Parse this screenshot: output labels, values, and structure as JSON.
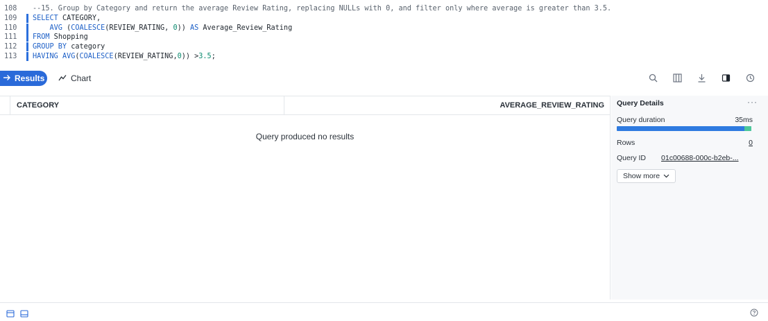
{
  "editor": {
    "lines": [
      {
        "num": "108",
        "segments": [
          {
            "t": "--15. Group by Category and return the average Review Rating, replacing NULLs with 0, and filter only where average is greater than 3.5.",
            "c": "cm"
          }
        ],
        "bar": false
      },
      {
        "num": "109",
        "segments": [
          {
            "t": "SELECT",
            "c": "kw"
          },
          {
            "t": " CATEGORY,",
            "c": "id"
          }
        ],
        "bar": true
      },
      {
        "num": "110",
        "segments": [
          {
            "t": "    AVG",
            "c": "fn"
          },
          {
            "t": " (",
            "c": "id"
          },
          {
            "t": "COALESCE",
            "c": "fn"
          },
          {
            "t": "(REVIEW_RATING, ",
            "c": "id"
          },
          {
            "t": "0",
            "c": "num"
          },
          {
            "t": ")) ",
            "c": "id"
          },
          {
            "t": "AS",
            "c": "kw"
          },
          {
            "t": " Average_Review_Rating",
            "c": "id"
          }
        ],
        "bar": true
      },
      {
        "num": "111",
        "segments": [
          {
            "t": "FROM",
            "c": "kw"
          },
          {
            "t": " Shopping",
            "c": "id"
          }
        ],
        "bar": true
      },
      {
        "num": "112",
        "segments": [
          {
            "t": "GROUP BY",
            "c": "kw"
          },
          {
            "t": " category",
            "c": "id"
          }
        ],
        "bar": true
      },
      {
        "num": "113",
        "segments": [
          {
            "t": "HAVING",
            "c": "kw"
          },
          {
            "t": " ",
            "c": "id"
          },
          {
            "t": "AVG",
            "c": "fn"
          },
          {
            "t": "(",
            "c": "id"
          },
          {
            "t": "COALESCE",
            "c": "fn"
          },
          {
            "t": "(REVIEW_RATING,",
            "c": "id"
          },
          {
            "t": "0",
            "c": "num"
          },
          {
            "t": ")) >",
            "c": "id"
          },
          {
            "t": "3.5",
            "c": "num"
          },
          {
            "t": ";",
            "c": "id"
          }
        ],
        "bar": true
      }
    ]
  },
  "toolbar": {
    "results_label": "Results",
    "chart_label": "Chart",
    "icons": [
      "search-icon",
      "columns-icon",
      "download-icon",
      "panel-toggle-icon",
      "history-icon"
    ]
  },
  "grid": {
    "columns": [
      "CATEGORY",
      "AVERAGE_REVIEW_RATING"
    ],
    "empty_message": "Query produced no results"
  },
  "details": {
    "title": "Query Details",
    "more": "···",
    "duration_label": "Query duration",
    "duration_value": "35ms",
    "duration_bar_fraction": 0.95,
    "rows_label": "Rows",
    "rows_value": "0",
    "query_id_label": "Query ID",
    "query_id_value": "01c00688-000c-b2eb-...",
    "show_more_label": "Show more"
  },
  "colors": {
    "accent": "#2a6ad9",
    "bar_primary": "#2f7be0",
    "bar_secondary": "#4cc79a"
  }
}
